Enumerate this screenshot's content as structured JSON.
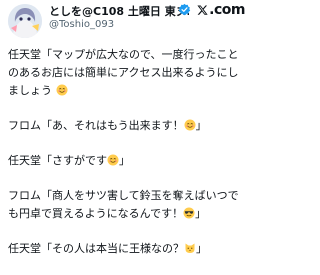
{
  "author": {
    "display_name": "としを@C108 土曜日 東ヌ…",
    "handle": "@Toshio_093",
    "avatar": "anime-avatar",
    "verified_icon": "verified-badge-icon"
  },
  "platform": {
    "logo": "x-logo-icon",
    "label": ".com"
  },
  "tweet": {
    "paragraphs": [
      {
        "text": "任天堂「マップが広大なので、一度行ったことのあるお店には簡単にアクセス出来るようにしましょう",
        "emoji": "smiling-face-emoji"
      },
      {
        "text": "フロム「あ、それはもう出来ます！",
        "emoji": "smiling-face-emoji",
        "after": "」"
      },
      {
        "text": "任天堂「さすがです",
        "emoji": "smiling-face-emoji",
        "after": "」"
      },
      {
        "text": "フロム「商人をサツ害して鈴玉を奪えばいつでも円卓で買えるようになるんです！",
        "emoji": "sunglasses-emoji",
        "after": "」"
      },
      {
        "text": "任天堂「その人は本当に王様なの？",
        "emoji": "cat-face-emoji",
        "after": "」"
      }
    ]
  },
  "colors": {
    "text": "#0f1419",
    "secondary_text": "#536471",
    "verified": "#1d9bf0",
    "emoji_yellow": "#ffcc4d"
  }
}
